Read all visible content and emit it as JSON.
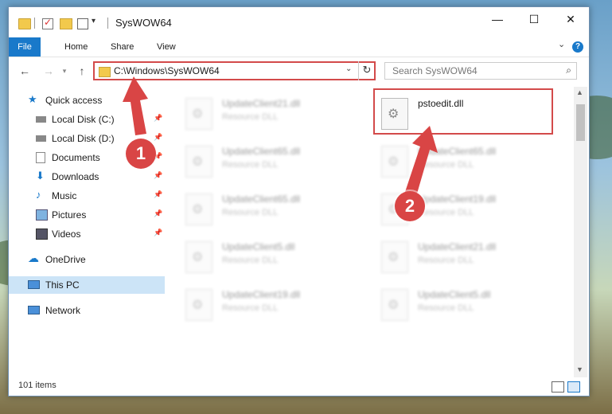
{
  "window": {
    "title": "SysWOW64",
    "controls": {
      "minimize": "—",
      "maximize": "☐",
      "close": "✕"
    }
  },
  "ribbon": {
    "tabs": [
      "File",
      "Home",
      "Share",
      "View"
    ],
    "help": "?"
  },
  "navigation": {
    "address": "C:\\Windows\\SysWOW64",
    "search_placeholder": "Search SysWOW64"
  },
  "sidebar": {
    "items": [
      {
        "label": "Quick access",
        "icon": "star-icon"
      },
      {
        "label": "Local Disk (C:)",
        "icon": "drive-icon",
        "pinned": true
      },
      {
        "label": "Local Disk (D:)",
        "icon": "drive-icon",
        "pinned": true
      },
      {
        "label": "Documents",
        "icon": "documents-icon",
        "pinned": true
      },
      {
        "label": "Downloads",
        "icon": "download-icon",
        "pinned": true
      },
      {
        "label": "Music",
        "icon": "music-icon",
        "pinned": true
      },
      {
        "label": "Pictures",
        "icon": "pictures-icon",
        "pinned": true
      },
      {
        "label": "Videos",
        "icon": "videos-icon",
        "pinned": true
      },
      {
        "label": "OneDrive",
        "icon": "cloud-icon"
      },
      {
        "label": "This PC",
        "icon": "computer-icon",
        "selected": true
      },
      {
        "label": "Network",
        "icon": "network-icon"
      }
    ]
  },
  "files": {
    "highlighted": {
      "name": "pstoedit.dll"
    },
    "left_column": [
      {
        "name": "UpdateClient21.dll",
        "type": "Resource DLL"
      },
      {
        "name": "UpdateClient65.dll",
        "type": "Resource DLL"
      },
      {
        "name": "UpdateClient65.dll",
        "type": "Resource DLL"
      },
      {
        "name": "UpdateClient5.dll",
        "type": "Resource DLL"
      },
      {
        "name": "UpdateClient19.dll",
        "type": "Resource DLL"
      }
    ],
    "right_column": [
      {
        "name": "UpdateClient65.dll",
        "type": "Resource DLL"
      },
      {
        "name": "UpdateClient19.dll",
        "type": "Resource DLL"
      },
      {
        "name": "UpdateClient21.dll",
        "type": "Resource DLL"
      },
      {
        "name": "UpdateClient5.dll",
        "type": "Resource DLL"
      }
    ]
  },
  "status": {
    "items_count": "101 items"
  },
  "annotations": {
    "step1": "1",
    "step2": "2",
    "color": "#d94545"
  }
}
